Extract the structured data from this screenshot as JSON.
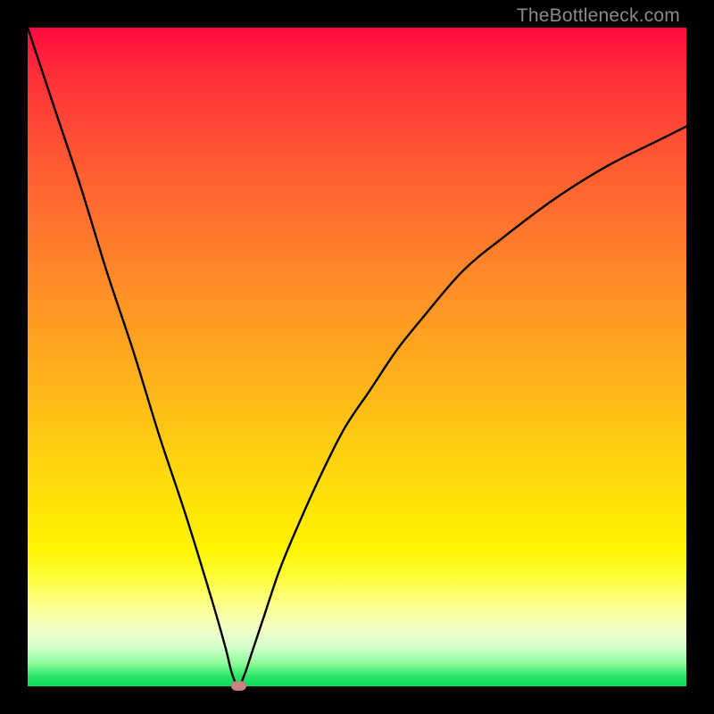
{
  "watermark": "TheBottleneck.com",
  "colors": {
    "frame": "#000000",
    "curve": "#000000",
    "marker": "#c98383",
    "gradient_top": "#ff0a3c",
    "gradient_bottom": "#0bd95c"
  },
  "chart_data": {
    "type": "line",
    "title": "",
    "xlabel": "",
    "ylabel": "",
    "xlim": [
      0,
      100
    ],
    "ylim": [
      0,
      100
    ],
    "note": "Axes are unlabeled; x and y are normalized 0-100. Curve is a V-shaped bottleneck curve reaching 0 at x≈32, with a marker at the minimum.",
    "series": [
      {
        "name": "bottleneck-curve",
        "x": [
          0,
          4,
          8,
          12,
          16,
          20,
          24,
          28,
          30,
          31,
          32,
          33,
          34,
          36,
          38,
          40,
          44,
          48,
          52,
          56,
          60,
          66,
          72,
          80,
          88,
          96,
          100
        ],
        "y": [
          100,
          88,
          76,
          63,
          51,
          38,
          26,
          13,
          6,
          2,
          0,
          2,
          5,
          11,
          17,
          22,
          31,
          39,
          45,
          51,
          56,
          63,
          68,
          74,
          79,
          83,
          85
        ]
      }
    ],
    "marker": {
      "x": 32,
      "y": 0
    }
  }
}
